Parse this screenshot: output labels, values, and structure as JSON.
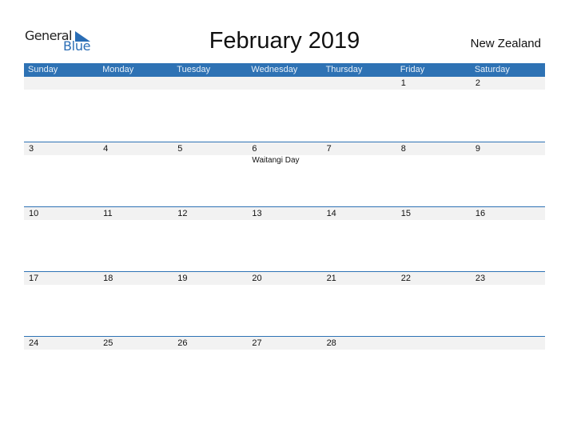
{
  "logo": {
    "line1": "General",
    "line2": "Blue",
    "icon": "triangle-flag-icon"
  },
  "header": {
    "title": "February 2019",
    "country": "New Zealand"
  },
  "colors": {
    "accent": "#2e72b4",
    "date_row_bg": "#f2f2f2"
  },
  "weekdays": [
    "Sunday",
    "Monday",
    "Tuesday",
    "Wednesday",
    "Thursday",
    "Friday",
    "Saturday"
  ],
  "weeks": [
    {
      "days": [
        "",
        "",
        "",
        "",
        "",
        "1",
        "2"
      ],
      "events": [
        "",
        "",
        "",
        "",
        "",
        "",
        ""
      ]
    },
    {
      "days": [
        "3",
        "4",
        "5",
        "6",
        "7",
        "8",
        "9"
      ],
      "events": [
        "",
        "",
        "",
        "Waitangi Day",
        "",
        "",
        ""
      ]
    },
    {
      "days": [
        "10",
        "11",
        "12",
        "13",
        "14",
        "15",
        "16"
      ],
      "events": [
        "",
        "",
        "",
        "",
        "",
        "",
        ""
      ]
    },
    {
      "days": [
        "17",
        "18",
        "19",
        "20",
        "21",
        "22",
        "23"
      ],
      "events": [
        "",
        "",
        "",
        "",
        "",
        "",
        ""
      ]
    },
    {
      "days": [
        "24",
        "25",
        "26",
        "27",
        "28",
        "",
        ""
      ],
      "events": [
        "",
        "",
        "",
        "",
        "",
        "",
        ""
      ]
    }
  ]
}
